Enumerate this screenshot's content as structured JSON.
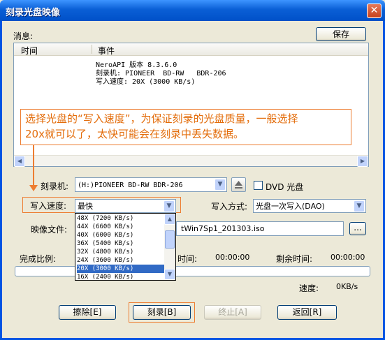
{
  "window": {
    "title": "刻录光盘映像",
    "close_glyph": "✕"
  },
  "messages": {
    "label": "消息:",
    "save_button": "保存"
  },
  "log": {
    "columns": [
      "时间",
      "事件"
    ],
    "lines": [
      "NeroAPI 版本 8.3.6.0",
      "刻录机: PIONEER  BD-RW   BDR-206",
      "写入速度: 20X (3000 KB/s)"
    ]
  },
  "callout": {
    "line1": "选择光盘的“写入速度”，为保证刻录的光盘质量，一般选择",
    "line2": "20x就可以了，太快可能会在刻录中丢失数据。"
  },
  "recorder": {
    "label": "刻录机:",
    "value": "(H:)PIONEER  BD-RW   BDR-206",
    "dvd_checkbox_label": "DVD 光盘",
    "dvd_checked": false
  },
  "speed": {
    "label": "写入速度:",
    "value": "最快",
    "options": [
      "48X (7200 KB/s)",
      "44X (6600 KB/s)",
      "40X (6000 KB/s)",
      "36X (5400 KB/s)",
      "32X (4800 KB/s)",
      "24X (3600 KB/s)",
      "20X (3000 KB/s)",
      "16X (2400 KB/s)"
    ],
    "selected_option": "20X (3000 KB/s)"
  },
  "write_mode": {
    "label": "写入方式:",
    "value": "光盘一次写入(DAO)"
  },
  "image_file": {
    "label": "映像文件:",
    "value": "tWin7Sp1_201303.iso",
    "browse_label": "..."
  },
  "progress": {
    "complete_label": "完成比例:",
    "time_label": "时间:",
    "time_value": "00:00:00",
    "remaining_label": "剩余时间:",
    "remaining_value": "00:00:00",
    "fraction": 0,
    "speed_label": "速度:",
    "speed_value": "0KB/s"
  },
  "buttons": {
    "erase": "擦除[E]",
    "burn": "刻录[B]",
    "stop": "终止[A]",
    "back": "返回[R]"
  },
  "colors": {
    "accent": "#ed7d31",
    "callout_text": "#e36c0a",
    "selection": "#316ac5",
    "titlebar": "#0054e3"
  }
}
